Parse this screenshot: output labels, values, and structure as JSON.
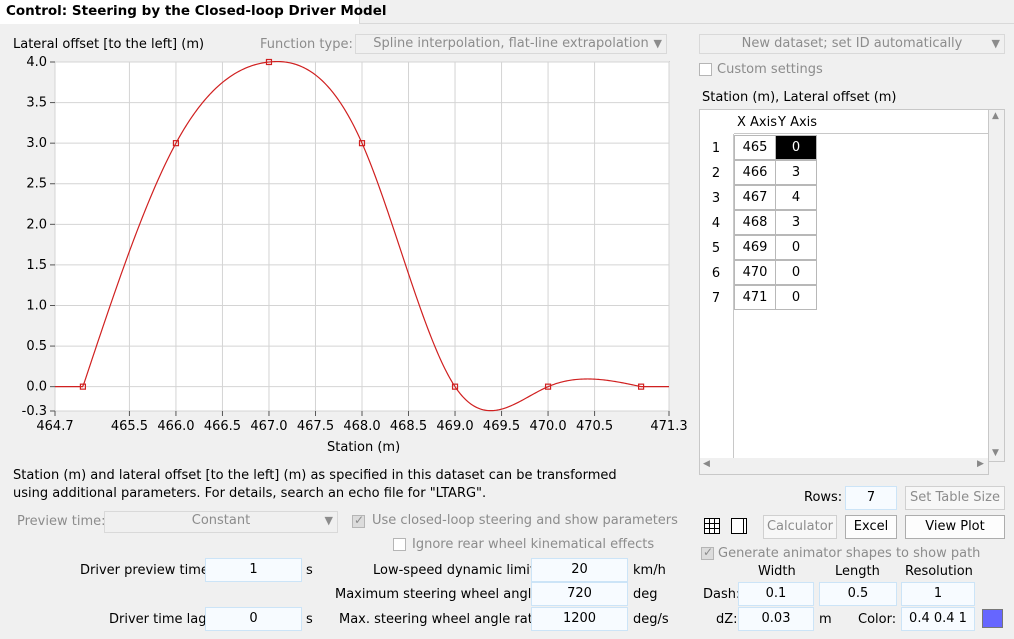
{
  "tab_title": "Control: Steering by the Closed-loop Driver Model",
  "chart": {
    "ylabel": "Lateral offset [to the left] (m)",
    "xlabel": "Station (m)",
    "function_type_label": "Function type:",
    "function_type_value": "Spline interpolation, flat-line extrapolation"
  },
  "chart_data": {
    "type": "line",
    "x": [
      465,
      466,
      467,
      468,
      469,
      470,
      471
    ],
    "y": [
      0,
      3,
      4,
      3,
      0,
      0,
      0
    ],
    "xlim": [
      464.7,
      471.3
    ],
    "ylim": [
      -0.3,
      4.0
    ],
    "x_ticks": [
      "464.7",
      "465.5",
      "466.0",
      "466.5",
      "467.0",
      "467.5",
      "468.0",
      "468.5",
      "469.0",
      "469.5",
      "470.0",
      "470.5",
      "471.3"
    ],
    "y_ticks": [
      "4.0",
      "3.5",
      "3.0",
      "2.5",
      "2.0",
      "1.5",
      "1.0",
      "0.5",
      "0.0",
      "-0.3"
    ],
    "xlabel": "Station (m)",
    "ylabel": "Lateral offset [to the left] (m)",
    "grid": true,
    "line_color": "#d02020"
  },
  "dataset": {
    "selector": "New dataset; set ID automatically",
    "custom_settings": "Custom settings",
    "table_title": "Station (m), Lateral offset (m)",
    "col_x": "X Axis",
    "col_y": "Y Axis",
    "rows": [
      {
        "n": "1",
        "x": "465",
        "y": "0"
      },
      {
        "n": "2",
        "x": "466",
        "y": "3"
      },
      {
        "n": "3",
        "x": "467",
        "y": "4"
      },
      {
        "n": "4",
        "x": "468",
        "y": "3"
      },
      {
        "n": "5",
        "x": "469",
        "y": "0"
      },
      {
        "n": "6",
        "x": "470",
        "y": "0"
      },
      {
        "n": "7",
        "x": "471",
        "y": "0"
      }
    ],
    "rows_label": "Rows:",
    "rows_value": "7",
    "set_table_size": "Set Table Size",
    "calculator": "Calculator",
    "excel": "Excel",
    "view_plot": "View Plot"
  },
  "note": {
    "line1": "Station (m) and lateral offset [to the left] (m) as specified in this dataset can be transformed",
    "line2": "using additional parameters. For details, search an echo file for \"LTARG\"."
  },
  "params": {
    "preview_time_label": "Preview time:",
    "preview_time_value": "Constant",
    "use_closed_loop": "Use closed-loop steering and show parameters",
    "ignore_rear": "Ignore rear wheel kinematical effects",
    "driver_preview_label": "Driver preview time:",
    "driver_preview_value": "1",
    "driver_preview_unit": "s",
    "driver_lag_label": "Driver time lag:",
    "driver_lag_value": "0",
    "driver_lag_unit": "s",
    "low_speed_label": "Low-speed dynamic limit:",
    "low_speed_value": "20",
    "low_speed_unit": "km/h",
    "max_angle_label": "Maximum steering wheel angle:",
    "max_angle_value": "720",
    "max_angle_unit": "deg",
    "max_rate_label": "Max. steering wheel angle rate:",
    "max_rate_value": "1200",
    "max_rate_unit": "deg/s"
  },
  "animator": {
    "generate_label": "Generate animator shapes to show path",
    "col_width": "Width",
    "col_length": "Length",
    "col_resolution": "Resolution",
    "dash_label": "Dash:",
    "dash_width": "0.1",
    "dash_length": "0.5",
    "dash_resolution": "1",
    "dz_label": "dZ:",
    "dz_value": "0.03",
    "dz_unit": "m",
    "color_label": "Color:",
    "color_value": "0.4 0.4 1",
    "swatch_color": "#6666ff"
  }
}
